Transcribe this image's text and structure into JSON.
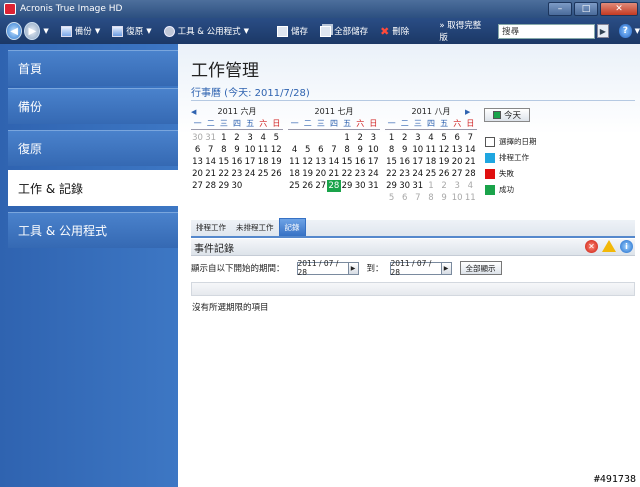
{
  "window": {
    "title": "Acronis True Image HD"
  },
  "toolbar": {
    "backup_label": "備份",
    "restore_label": "復原",
    "tools_label": "工具 & 公用程式",
    "save_label": "儲存",
    "save_all_label": "全部儲存",
    "delete_label": "刪除",
    "more_label": "»  取得完整版",
    "search_placeholder": "搜尋"
  },
  "sidebar": {
    "items": [
      {
        "label": "首頁"
      },
      {
        "label": "備份"
      },
      {
        "label": "復原"
      },
      {
        "label": "工作 & 記錄"
      },
      {
        "label": "工具 & 公用程式"
      }
    ]
  },
  "main": {
    "title": "工作管理",
    "calendar_header": "行事曆 (今天: 2011/7/28)"
  },
  "calendar": {
    "weekdays": [
      "一",
      "二",
      "三",
      "四",
      "五",
      "六",
      "日"
    ],
    "months": [
      {
        "title": "2011 六月",
        "days": [
          "30",
          "31",
          "1",
          "2",
          "3",
          "4",
          "5",
          "6",
          "7",
          "8",
          "9",
          "10",
          "11",
          "12",
          "13",
          "14",
          "15",
          "16",
          "17",
          "18",
          "19",
          "20",
          "21",
          "22",
          "23",
          "24",
          "25",
          "26",
          "27",
          "28",
          "29",
          "30",
          "",
          "",
          "",
          "",
          "",
          "",
          "",
          "",
          "",
          ""
        ],
        "dim": [
          0,
          1
        ]
      },
      {
        "title": "2011 七月",
        "days": [
          "",
          "",
          "",
          "",
          "1",
          "2",
          "3",
          "4",
          "5",
          "6",
          "7",
          "8",
          "9",
          "10",
          "11",
          "12",
          "13",
          "14",
          "15",
          "16",
          "17",
          "18",
          "19",
          "20",
          "21",
          "22",
          "23",
          "24",
          "25",
          "26",
          "27",
          "28",
          "29",
          "30",
          "31",
          "",
          "",
          "",
          "",
          "",
          "",
          ""
        ],
        "dim": []
      },
      {
        "title": "2011 八月",
        "days": [
          "1",
          "2",
          "3",
          "4",
          "5",
          "6",
          "7",
          "8",
          "9",
          "10",
          "11",
          "12",
          "13",
          "14",
          "15",
          "16",
          "17",
          "18",
          "19",
          "20",
          "21",
          "22",
          "23",
          "24",
          "25",
          "26",
          "27",
          "28",
          "29",
          "30",
          "31",
          "1",
          "2",
          "3",
          "4",
          "5",
          "6",
          "7",
          "8",
          "9",
          "10",
          "11"
        ],
        "dim": [
          31,
          32,
          33,
          34,
          35,
          36,
          37,
          38,
          39,
          40,
          41
        ]
      }
    ],
    "today_month": 1,
    "today_index": 31,
    "today_button": "今天"
  },
  "legend": [
    {
      "label": "選擇的日期",
      "color": "#ffffff"
    },
    {
      "label": "排程工作",
      "color": "#1fa6e0"
    },
    {
      "label": "失敗",
      "color": "#e01010"
    },
    {
      "label": "成功",
      "color": "#1aa34a"
    }
  ],
  "tabs": [
    {
      "label": "排程工作"
    },
    {
      "label": "未排程工作"
    },
    {
      "label": "記錄"
    }
  ],
  "log": {
    "title": "事件記錄",
    "filter_label": "顯示自以下開始的期間：",
    "from_date": "2011 / 07 / 28",
    "to_label": "到：",
    "to_date": "2011 / 07 / 28",
    "show_all_label": "全部顯示",
    "empty_message": "沒有所選期限的項目"
  },
  "watermark": "#491738"
}
